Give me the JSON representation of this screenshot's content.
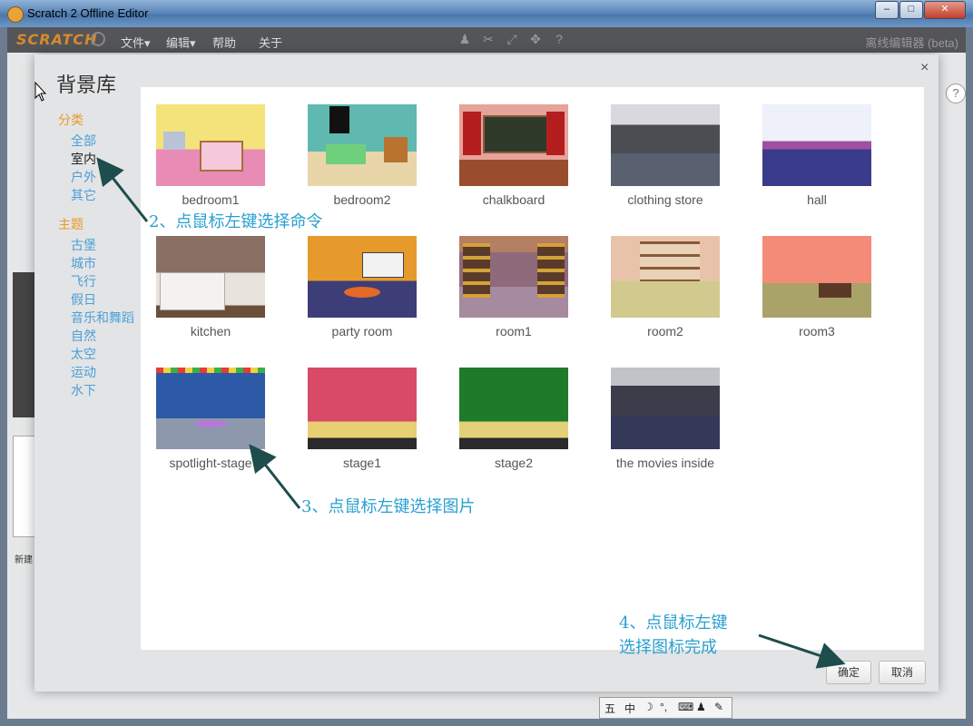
{
  "window": {
    "title": "Scratch 2 Offline Editor",
    "min": "–",
    "max": "□",
    "close": "✕"
  },
  "menu": {
    "logo": "SCRATCH",
    "file": "文件▾",
    "edit": "编辑▾",
    "help": "帮助",
    "about": "关于",
    "edition": "离线编辑器 (beta)"
  },
  "editor": {
    "new_label": "新建",
    "help": "?"
  },
  "dialog": {
    "title": "背景库",
    "close": "×",
    "category_heading": "分类",
    "categories": [
      "全部",
      "室内",
      "户外",
      "其它"
    ],
    "selected_category": "室内",
    "theme_heading": "主题",
    "themes": [
      "古堡",
      "城市",
      "飞行",
      "假日",
      "音乐和舞蹈",
      "自然",
      "太空",
      "运动",
      "水下"
    ],
    "ok": "确定",
    "cancel": "取消"
  },
  "backdrops": [
    "bedroom1",
    "bedroom2",
    "chalkboard",
    "clothing store",
    "hall",
    "kitchen",
    "party room",
    "room1",
    "room2",
    "room3",
    "spotlight-stage",
    "stage1",
    "stage2",
    "the movies inside"
  ],
  "annotations": {
    "step2": "2、点鼠标左键选择命令",
    "step3": "3、点鼠标左键选择图片",
    "step4_line1": "4、点鼠标左键",
    "step4_line2": "选择图标完成"
  },
  "ime": {
    "mode": "中"
  },
  "colors": {
    "accent_orange": "#e89a2a",
    "link_blue": "#4a9fd6",
    "annotation_blue": "#2a9fd0",
    "arrow": "#1f4d4d"
  }
}
